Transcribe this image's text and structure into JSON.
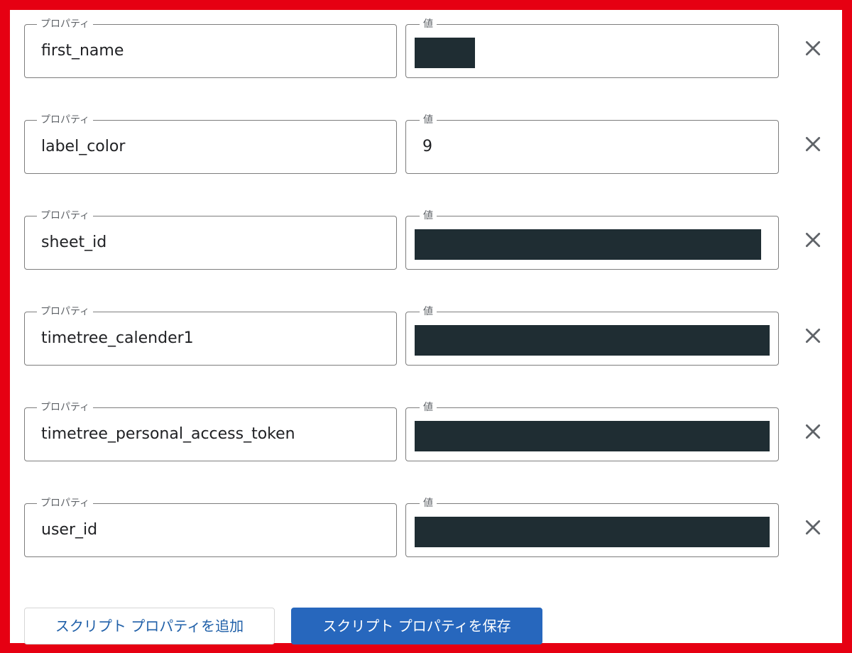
{
  "property_label": "プロパティ",
  "value_label": "値",
  "rows": [
    {
      "property": "first_name",
      "value": "",
      "value_redacted": true,
      "redaction_extent": 0.17
    },
    {
      "property": "label_color",
      "value": "9",
      "value_redacted": false
    },
    {
      "property": "sheet_id",
      "value": "",
      "value_redacted": true,
      "redaction_extent": 0.975
    },
    {
      "property": "timetree_calender1",
      "value": "",
      "value_redacted": true,
      "redaction_extent": 1.0
    },
    {
      "property": "timetree_personal_access_token",
      "value": "",
      "value_redacted": true,
      "redaction_extent": 1.0
    },
    {
      "property": "user_id",
      "value": "",
      "value_redacted": true,
      "redaction_extent": 1.0
    }
  ],
  "remove_icon": "close-icon",
  "buttons": {
    "add_label": "スクリプト プロパティを追加",
    "save_label": "スクリプト プロパティを保存"
  },
  "colors": {
    "frame": "#e60012",
    "redaction": "#1f2d33",
    "primary_button": "#2767bd",
    "secondary_button_text": "#1f5fa8"
  }
}
